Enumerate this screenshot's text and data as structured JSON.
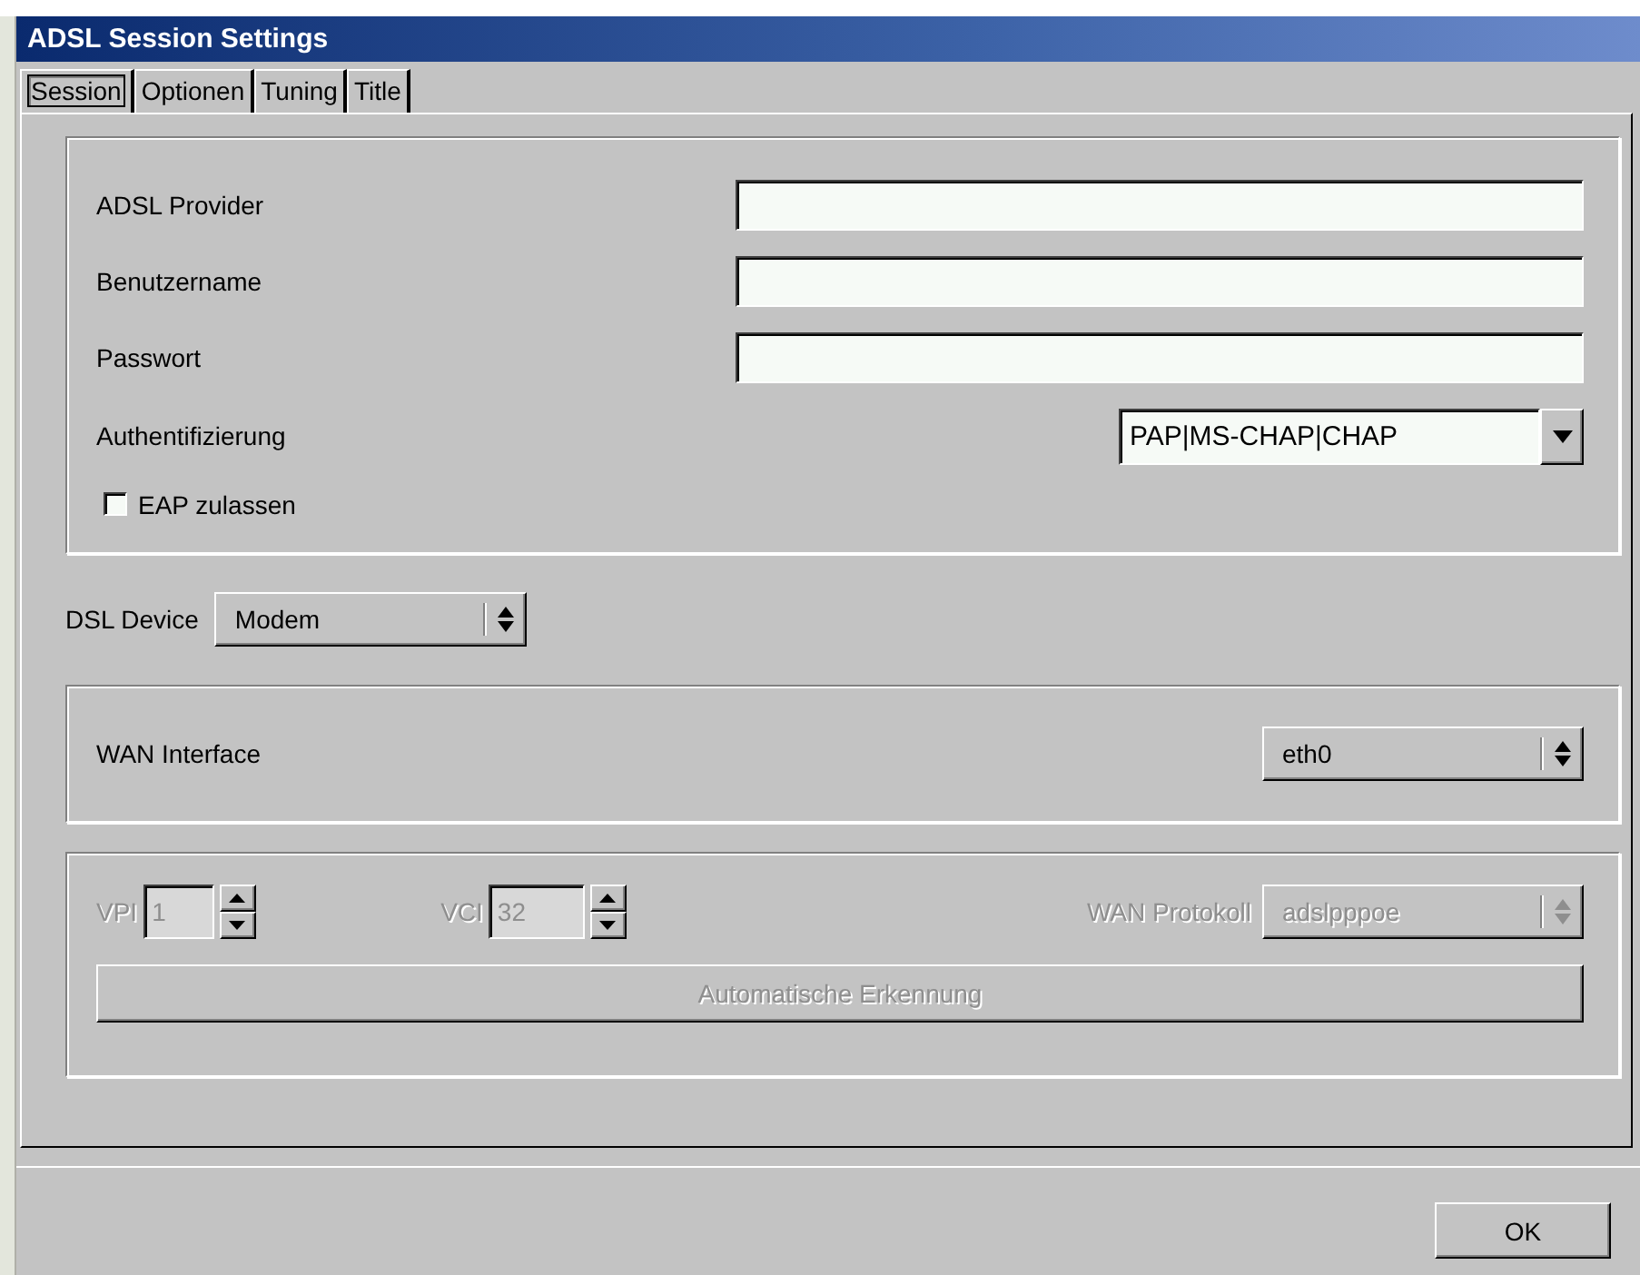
{
  "window": {
    "title": "ADSL Session Settings"
  },
  "tabs": [
    {
      "label": "Session",
      "selected": true
    },
    {
      "label": "Optionen",
      "selected": false
    },
    {
      "label": "Tuning",
      "selected": false
    },
    {
      "label": "Title",
      "selected": false
    }
  ],
  "account_group": {
    "fields": [
      {
        "label": "ADSL Provider"
      },
      {
        "label": "Benutzername"
      },
      {
        "label": "Passwort"
      }
    ],
    "authentication": {
      "label": "Authentifizierung",
      "kind": "editable",
      "value": "PAP|MS-CHAP|CHAP"
    },
    "eap": {
      "label": "EAP zulassen",
      "checked": false
    }
  },
  "dsl_device": {
    "label": "DSL Device",
    "kind": "option_menu",
    "value": "Modem"
  },
  "wan_interface": {
    "label": "WAN Interface",
    "kind": "option_menu",
    "value": "eth0"
  },
  "atm_group": {
    "disabled": true,
    "vpi": {
      "label": "VPI",
      "value": "1"
    },
    "vci": {
      "label": "VCI",
      "value": "32"
    },
    "wan_protocol": {
      "label": "WAN Protokoll",
      "kind": "option_menu",
      "value": "adslpppoe"
    },
    "detect_button": {
      "label": "Automatische Erkennung"
    }
  },
  "buttons": [
    {
      "label": "OK"
    }
  ]
}
